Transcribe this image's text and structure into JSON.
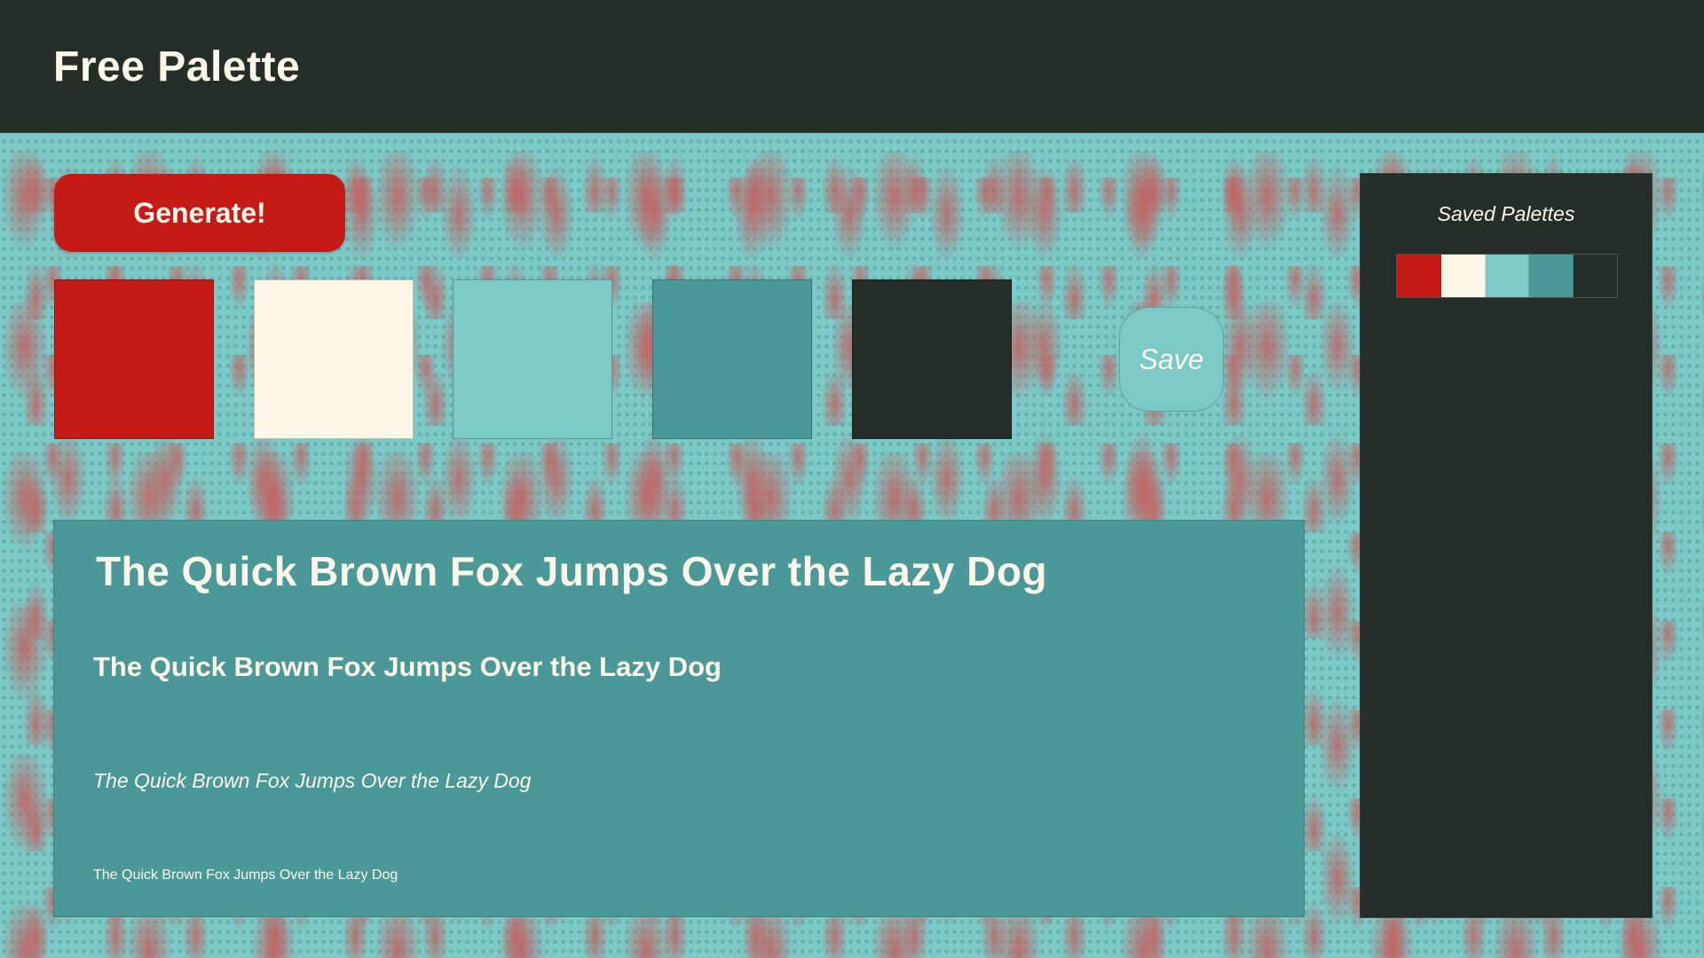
{
  "header": {
    "title": "Free Palette"
  },
  "controls": {
    "generate_label": "Generate!",
    "save_label": "Save"
  },
  "palette": {
    "colors": [
      "#c51a16",
      "#fdf7ea",
      "#7bcac8",
      "#4a9898",
      "#252d29"
    ]
  },
  "typography": {
    "samples": [
      "The Quick Brown Fox Jumps Over the Lazy Dog",
      "The Quick Brown Fox Jumps Over the Lazy Dog",
      "The Quick Brown Fox Jumps Over the Lazy Dog",
      "The Quick Brown Fox Jumps Over the Lazy Dog"
    ]
  },
  "saved": {
    "title": "Saved Palettes",
    "palettes": [
      {
        "colors": [
          "#c51a16",
          "#fdf7ea",
          "#7bcac8",
          "#4a9898",
          "#252d29"
        ]
      }
    ]
  }
}
